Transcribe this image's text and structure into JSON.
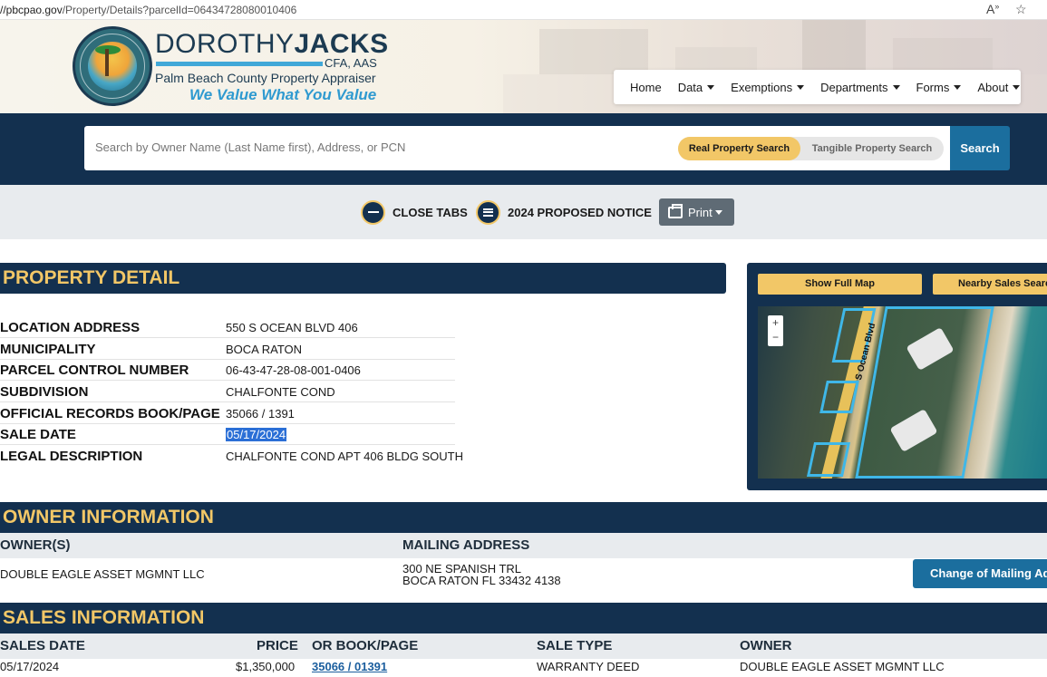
{
  "browser": {
    "url_domain": "//pbcpao.gov",
    "url_path": "/Property/Details?parcelId=06434728080010406",
    "read_aloud_icon": "read-aloud-icon",
    "favorite_icon": "star-icon"
  },
  "brand": {
    "name_light": "DOROTHY",
    "name_bold": "JACKS",
    "credentials": "CFA, AAS",
    "subtitle": "Palm Beach County Property Appraiser",
    "tagline": "We Value What You Value",
    "colors": {
      "navy": "#13304f",
      "gold": "#f2c767",
      "blue": "#1b6e9e",
      "sky": "#41a8d8"
    }
  },
  "nav": {
    "home": "Home",
    "data": "Data",
    "exemptions": "Exemptions",
    "departments": "Departments",
    "forms": "Forms",
    "about": "About"
  },
  "search": {
    "placeholder": "Search by Owner Name (Last Name first), Address, or PCN",
    "real_property": "Real Property Search",
    "tangible_property": "Tangible Property Search",
    "button": "Search"
  },
  "toolbar": {
    "close_tabs": "CLOSE TABS",
    "proposed_notice": "2024 PROPOSED NOTICE",
    "print": "Print"
  },
  "property_detail": {
    "title": "PROPERTY DETAIL",
    "rows": [
      {
        "label": "LOCATION ADDRESS",
        "value": "550 S OCEAN BLVD 406"
      },
      {
        "label": "MUNICIPALITY",
        "value": "BOCA RATON"
      },
      {
        "label": "PARCEL CONTROL NUMBER",
        "value": "06-43-47-28-08-001-0406"
      },
      {
        "label": "SUBDIVISION",
        "value": "CHALFONTE COND"
      },
      {
        "label": "OFFICIAL RECORDS BOOK/PAGE",
        "value": "35066 / 1391"
      },
      {
        "label": "SALE DATE",
        "value": "05/17/2024"
      },
      {
        "label": "LEGAL DESCRIPTION",
        "value": "CHALFONTE COND APT 406 BLDG SOUTH"
      }
    ]
  },
  "map": {
    "show_full_map": "Show Full Map",
    "nearby_sales": "Nearby Sales Search",
    "zoom_in": "+",
    "zoom_out": "−",
    "road_label": "S Ocean Blvd"
  },
  "owner": {
    "title": "OWNER INFORMATION",
    "owners_header": "OWNER(S)",
    "mailing_header": "MAILING ADDRESS",
    "owner_name": "DOUBLE EAGLE ASSET MGMNT LLC",
    "mailing_line1": "300 NE SPANISH TRL",
    "mailing_line2": "BOCA RATON FL 33432 4138",
    "change_button": "Change of Mailing Address"
  },
  "sales": {
    "title": "SALES INFORMATION",
    "headers": {
      "date": "SALES DATE",
      "price": "PRICE",
      "book": "OR BOOK/PAGE",
      "type": "SALE TYPE",
      "owner": "OWNER"
    },
    "rows": [
      {
        "date": "05/17/2024",
        "price": "$1,350,000",
        "book": "35066 / 01391",
        "type": "WARRANTY DEED",
        "owner": "DOUBLE EAGLE ASSET MGMNT LLC"
      }
    ]
  }
}
